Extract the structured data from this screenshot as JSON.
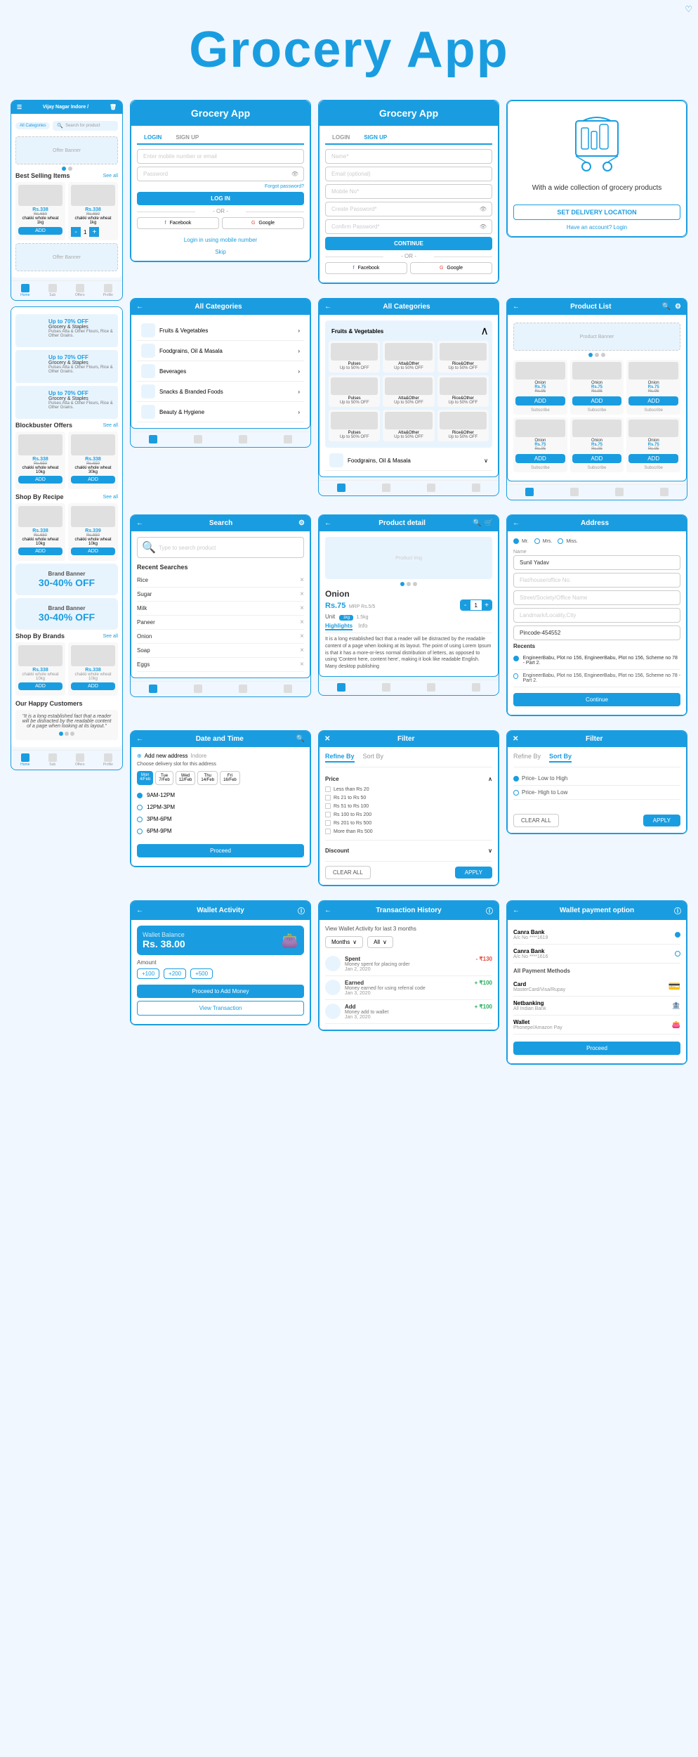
{
  "app": {
    "title": "Grocery App",
    "tagline": "With a wide collection of grocery products"
  },
  "login_screen": {
    "title": "Grocery App",
    "tab_login": "LOGIN",
    "tab_signup": "SIGN UP",
    "placeholder_email": "Enter mobile number or email",
    "placeholder_password": "Password",
    "forgot_password": "Forgot password?",
    "btn_login": "LOG IN",
    "or_text": "- OR -",
    "btn_facebook": "Facebook",
    "btn_google": "Google",
    "btn_mobile": "Login in using mobile number",
    "skip": "Skip"
  },
  "signup_screen": {
    "title": "Grocery App",
    "tab_login": "LOGIN",
    "tab_signup": "SIGN UP",
    "field_name": "Name*",
    "field_email": "Email (optional)",
    "field_mobile": "Mobile No*",
    "field_password": "Create Password*",
    "field_confirm": "Confirm Password*",
    "btn_continue": "CONTINUE",
    "or_text": "- OR -",
    "btn_facebook": "Facebook",
    "btn_google": "Google"
  },
  "splash_screen": {
    "title": "Grocery App",
    "tagline": "With a wide collection of grocery products",
    "btn_delivery": "SET DELIVERY LOCATION",
    "have_account": "Have an account? Login"
  },
  "home_screen": {
    "location": "Vijay Nagar Indore /",
    "search_placeholder": "Search for product",
    "offer_banner": "Offer Banner",
    "best_selling": "Best Selling Items",
    "see_all": "See all",
    "product1_price": "Rs.338",
    "product1_old": "Rs.650",
    "product1_name": "chakki whole wheat 1kg",
    "product2_price": "Rs.338",
    "product2_old": "Rs.650",
    "product2_name": "chakki whole wheat 1kg",
    "add_btn": "ADD",
    "offer_banner2": "Offer Banner"
  },
  "all_categories": {
    "title": "All Categories",
    "cats": [
      {
        "name": "Fruits & Vegetables"
      },
      {
        "name": "Foodgrains, Oil & Masala"
      },
      {
        "name": "Beverages"
      },
      {
        "name": "Snacks & Branded Foods"
      },
      {
        "name": "Beauty & Hygiene"
      }
    ]
  },
  "product_list": {
    "title": "Product List",
    "product_banner": "Product Banner",
    "products": [
      {
        "name": "Onion",
        "price": "Rs.75",
        "mrp": "MRP Rs.5/5"
      },
      {
        "name": "Onion",
        "price": "Rs.75",
        "old": "Rs.95"
      },
      {
        "name": "Onion",
        "price": "Rs.75",
        "old": "Rs.95"
      },
      {
        "name": "Onion",
        "price": "Rs.75",
        "old": "Rs.95"
      },
      {
        "name": "Onion",
        "price": "Rs.75",
        "old": "Rs.95"
      },
      {
        "name": "Onion",
        "price": "Rs.75",
        "old": "Rs.95"
      }
    ]
  },
  "search_screen": {
    "title": "Search",
    "placeholder": "Type to search product",
    "recent_title": "Recent Searches",
    "recent_items": [
      "Rice",
      "Sugar",
      "Milk",
      "Paneer",
      "Onion",
      "Soap",
      "Eggs"
    ]
  },
  "product_detail": {
    "title": "Product detail",
    "name": "Onion",
    "price": "Rs.75",
    "mrp": "MRP Rs.5/5",
    "unit": "Unit",
    "unit_options": [
      "1kg",
      "1.5kg"
    ],
    "highlights": "Highlights",
    "info": "Info",
    "description": "It is a long established fact that a reader will be distracted by the readable content of a page when looking at its layout. The point of using Lorem Ipsum is that it has a more-or-less normal distribution of letters, as opposed to using 'Content here, content here', making it look like readable English. Many desktop publishing"
  },
  "address_screen": {
    "title": "Address",
    "mr": "Mr.",
    "mrs": "Mrs.",
    "miss": "Miss.",
    "field_name": "Sunil Yadav",
    "field_flat": "Flat/house/office No.",
    "field_street": "Street/Society/Office Name",
    "field_landmark": "Landmark/Locality,City",
    "pincode": "Pincode-454552",
    "recents_title": "Recents",
    "address1": "EngineerBabu, Plot no 156, EngineerBabu, Plot no 156, Scheme no 78 - Part 2.",
    "address2": "EngineerBabu, Plot no 156, EngineerBabu, Plot no 156, Scheme no 78 - Part 2.",
    "btn_continue": "Continue"
  },
  "datetime_screen": {
    "title": "Date and Time",
    "add_address": "Add new address",
    "city": "Indore",
    "choose_delivery": "Choose delivery slot for this address",
    "days": [
      "Mon 4/Feb",
      "Tue 7/Feb",
      "Wed 12/Feb",
      "Thu 14/Feb",
      "Fri 16/Feb"
    ],
    "slots": [
      "9AM-12PM",
      "12PM-3PM",
      "3PM-6PM",
      "6PM-9PM"
    ],
    "btn_proceed": "Proceed"
  },
  "filter_screen": {
    "title": "Filter",
    "refine_by": "Refine By",
    "sort_by": "Sort By",
    "price_section": "Price",
    "price_options": [
      "Less than Rs 20",
      "Rs 21 to Rs 50",
      "Rs 51 to Rs 100",
      "Rs 100 to Rs 200",
      "Rs 201 to Rs 500",
      "More than Rs 500"
    ],
    "discount_section": "Discount",
    "sort_options": [
      "Price- Low to High",
      "Price- High to Low"
    ],
    "btn_clear": "CLEAR ALL",
    "btn_apply": "APPLY"
  },
  "wallet_screen": {
    "title": "Wallet Activity",
    "balance_label": "Wallet Balance",
    "balance": "Rs. 38.00",
    "amount_chips": [
      "+100",
      "+200",
      "+500"
    ],
    "btn_add": "Proceed to Add Money",
    "btn_view": "View Transaction"
  },
  "transaction_screen": {
    "title": "Transaction History",
    "view_label": "View Wallet Activity for last 3 months",
    "months": "Months",
    "all": "All",
    "transactions": [
      {
        "type": "Spent",
        "desc": "Money spent for placing order",
        "amount": "- ₹130",
        "date": "Jan 2, 2020"
      },
      {
        "type": "Earned",
        "desc": "Money earned for using referral code",
        "amount": "+ ₹100",
        "date": "Jan 3, 2020"
      },
      {
        "type": "Add",
        "desc": "Money add to wallet",
        "amount": "+ ₹100",
        "date": "Jan 3, 2020"
      }
    ]
  },
  "wallet_payment": {
    "title": "Wallet payment option",
    "bank1_name": "Canra Bank",
    "bank1_acc": "A/c No ****1619",
    "bank2_name": "Canra Bank",
    "bank2_acc": "A/c No ****1616",
    "all_methods": "All Payment Methods",
    "card": "Card",
    "card_sub": "MasterCard/Visa/Rupay",
    "netbanking": "Netbanking",
    "netbanking_sub": "All Indian Bank",
    "wallet": "Wallet",
    "wallet_sub": "Phonepe/Amazon Pay",
    "btn_proceed": "Proceed"
  },
  "left_app": {
    "title": "Grocery App",
    "offers": [
      {
        "title": "Up to 70% OFF",
        "subtitle": "Grocery & Staples",
        "desc": "Pulses Atta & Other Flours, Rice & Other Grains."
      },
      {
        "title": "Up to 70% OFF",
        "subtitle": "Grocery & Staples",
        "desc": "Pulses Atta & Other Flours, Rice & Other Grains."
      },
      {
        "title": "Up to 70% OFF",
        "subtitle": "Grocery & Staples",
        "desc": "Pulses Atta & Other Flours, Rice & Other Grains."
      }
    ],
    "blockbuster": "Blockbuster Offers",
    "shop_recipe": "Shop By Recipe",
    "brand_banner": "Brand Banner",
    "brand_discount": "30-40% OFF",
    "shop_brands": "Shop By Brands",
    "happy_customers": "Our Happy Customers",
    "testimonial": "\"It is a long established fact that a reader will be distracted by the readable content of a page when looking at its layout.\""
  }
}
